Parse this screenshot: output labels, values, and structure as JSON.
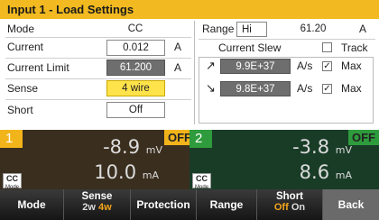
{
  "title": "Input 1 - Load Settings",
  "settings": {
    "mode": {
      "label": "Mode",
      "value": "CC"
    },
    "current": {
      "label": "Current",
      "value": "0.012",
      "unit": "A"
    },
    "current_limit": {
      "label": "Current Limit",
      "value": "61.200",
      "unit": "A"
    },
    "sense": {
      "label": "Sense",
      "value": "4 wire"
    },
    "short": {
      "label": "Short",
      "value": "Off"
    },
    "range": {
      "label": "Range",
      "value": "Hi",
      "limit": "61.20",
      "unit": "A"
    },
    "current_slew": {
      "label": "Current Slew",
      "track_label": "Track",
      "track_checked": false,
      "rise": {
        "value": "9.9E+37",
        "unit": "A/s",
        "max_label": "Max",
        "max_checked": true
      },
      "fall": {
        "value": "9.8E+37",
        "unit": "A/s",
        "max_label": "Max",
        "max_checked": true
      }
    }
  },
  "channels": [
    {
      "number": "1",
      "status": "OFF",
      "voltage": "-8.9",
      "voltage_unit": "mV",
      "current": "10.0",
      "current_unit": "mA",
      "mode": "CC",
      "mode_sub": "Mode"
    },
    {
      "number": "2",
      "status": "OFF",
      "voltage": "-3.8",
      "voltage_unit": "mV",
      "current": "8.6",
      "current_unit": "mA",
      "mode": "CC",
      "mode_sub": "Mode"
    }
  ],
  "softkeys": {
    "mode": "Mode",
    "sense": {
      "label": "Sense",
      "opt1": "2w",
      "opt2": "4w"
    },
    "protection": "Protection",
    "range": "Range",
    "short": {
      "label": "Short",
      "opt1": "Off",
      "opt2": "On"
    },
    "back": "Back"
  }
}
